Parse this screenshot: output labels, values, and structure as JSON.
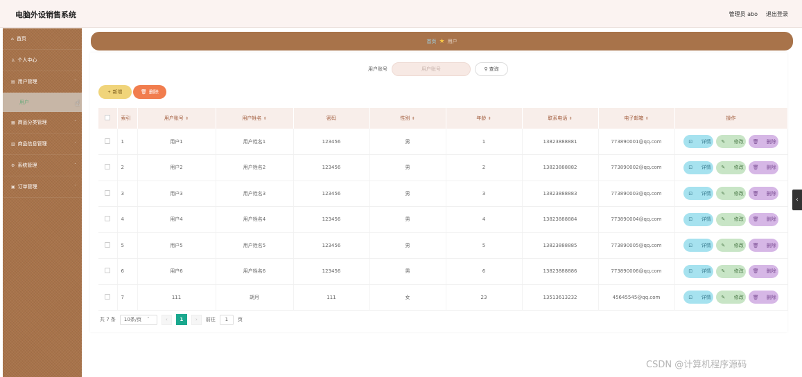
{
  "header": {
    "title": "电脑外设销售系统",
    "user": "管理员 abo",
    "logout": "退出登录"
  },
  "sidebar": {
    "items": [
      {
        "label": "首页",
        "icon": "home-icon"
      },
      {
        "label": "个人中心",
        "icon": "person-icon"
      },
      {
        "label": "用户管理",
        "icon": "users-icon"
      },
      {
        "label": "商品分类管理",
        "icon": "category-icon"
      },
      {
        "label": "商品信息管理",
        "icon": "chart-icon"
      },
      {
        "label": "系统管理",
        "icon": "gear-icon"
      },
      {
        "label": "订单管理",
        "icon": "order-icon"
      }
    ],
    "sub_item": "用户"
  },
  "breadcrumb": {
    "home": "首页",
    "current": "用户"
  },
  "search": {
    "label": "用户账号",
    "placeholder": "用户账号",
    "button": "查询"
  },
  "actions": {
    "add": "新增",
    "delete": "删除"
  },
  "table": {
    "headers": [
      "索引",
      "用户账号",
      "用户姓名",
      "密码",
      "性别",
      "年龄",
      "联系电话",
      "电子邮箱",
      "操作"
    ],
    "rows": [
      {
        "index": "1",
        "account": "用户1",
        "name": "用户姓名1",
        "password": "123456",
        "gender": "男",
        "age": "1",
        "phone": "13823888881",
        "email": "773890001@qq.com"
      },
      {
        "index": "2",
        "account": "用户2",
        "name": "用户姓名2",
        "password": "123456",
        "gender": "男",
        "age": "2",
        "phone": "13823888882",
        "email": "773890002@qq.com"
      },
      {
        "index": "3",
        "account": "用户3",
        "name": "用户姓名3",
        "password": "123456",
        "gender": "男",
        "age": "3",
        "phone": "13823888883",
        "email": "773890003@qq.com"
      },
      {
        "index": "4",
        "account": "用户4",
        "name": "用户姓名4",
        "password": "123456",
        "gender": "男",
        "age": "4",
        "phone": "13823888884",
        "email": "773890004@qq.com"
      },
      {
        "index": "5",
        "account": "用户5",
        "name": "用户姓名5",
        "password": "123456",
        "gender": "男",
        "age": "5",
        "phone": "13823888885",
        "email": "773890005@qq.com"
      },
      {
        "index": "6",
        "account": "用户6",
        "name": "用户姓名6",
        "password": "123456",
        "gender": "男",
        "age": "6",
        "phone": "13823888886",
        "email": "773890006@qq.com"
      },
      {
        "index": "7",
        "account": "111",
        "name": "胡月",
        "password": "111",
        "gender": "女",
        "age": "23",
        "phone": "13513613232",
        "email": "45645545@qq.com"
      }
    ],
    "row_actions": {
      "detail": "详情",
      "edit": "修改",
      "delete": "删除"
    }
  },
  "pagination": {
    "total": "共 7 条",
    "page_size": "10条/页",
    "current_page": "1",
    "goto_label": "前往",
    "goto_value": "1",
    "page_suffix": "页"
  },
  "watermark": "CSDN @计算机程序源码",
  "colors": {
    "sidebar": "#a8734a",
    "accent_add": "#f0d47a",
    "accent_delete": "#f17d4e",
    "detail": "#a6e2ef",
    "edit": "#c8e5c6",
    "remove": "#d6b7e6",
    "page_active": "#1aa88e"
  }
}
